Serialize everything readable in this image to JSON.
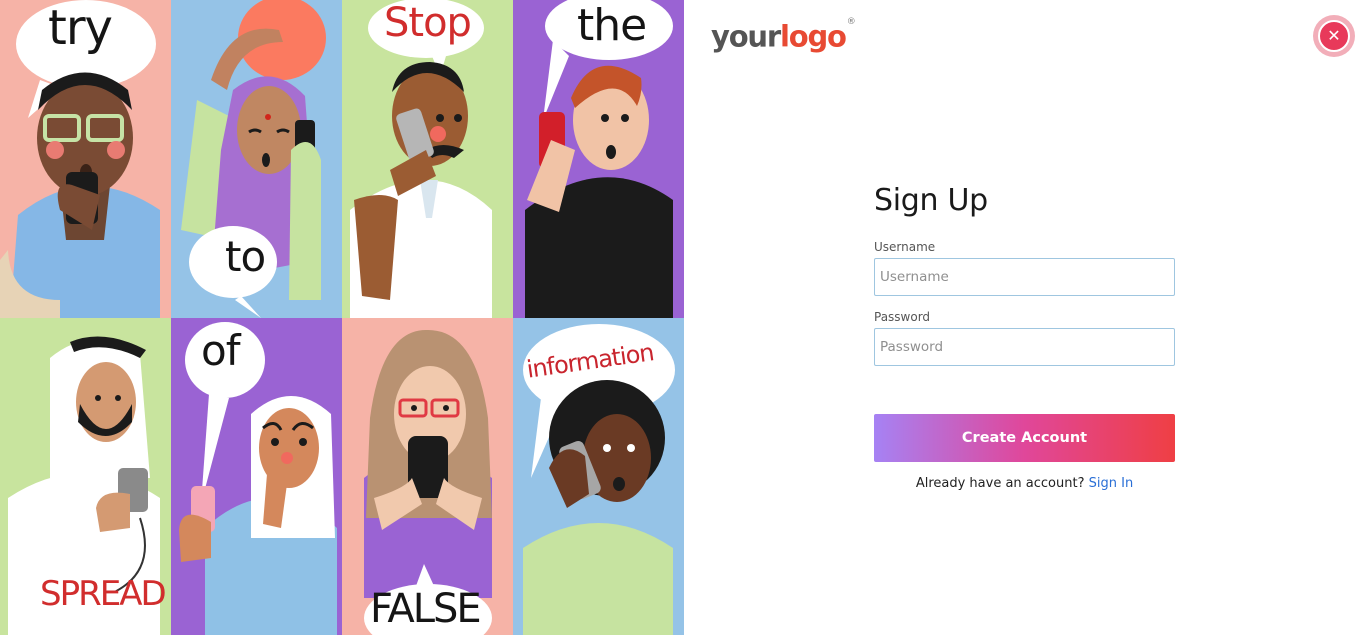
{
  "illustration": {
    "words": [
      "try",
      "to",
      "Stop",
      "the",
      "SPREAD",
      "of",
      "FALSE",
      "information"
    ]
  },
  "logo": {
    "part1": "your",
    "part2": "logo",
    "mark": "®"
  },
  "close_icon": "close-icon",
  "form": {
    "title": "Sign Up",
    "username_label": "Username",
    "username_placeholder": "Username",
    "username_value": "",
    "password_label": "Password",
    "password_placeholder": "Password",
    "password_value": "",
    "submit_label": "Create Account",
    "signin_prompt": "Already have an account?",
    "signin_link": "Sign In"
  },
  "colors": {
    "logo_dark": "#555555",
    "logo_accent": "#e84a33",
    "close_button": "#e8395a",
    "gradient_start": "#a682f4",
    "gradient_mid": "#e0479a",
    "gradient_end": "#ef3f44",
    "link": "#2a6fd6"
  }
}
